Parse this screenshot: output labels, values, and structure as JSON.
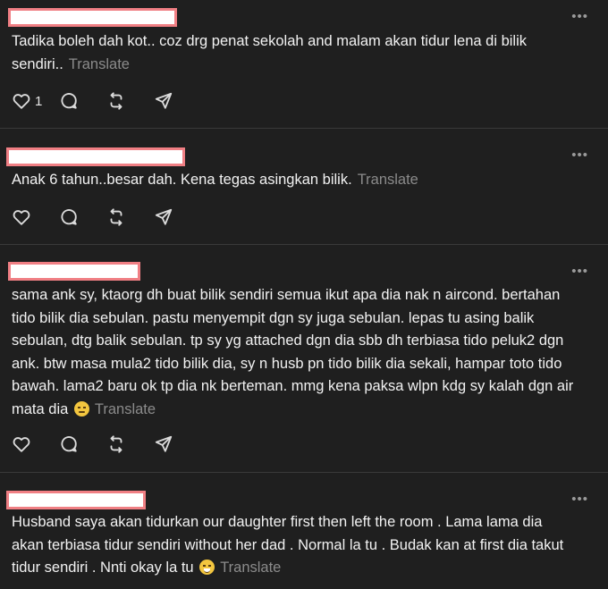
{
  "ui": {
    "translate_label": "Translate",
    "more_label": "•••"
  },
  "posts": [
    {
      "text": "Tadika boleh dah kot.. coz drg penat sekolah and malam akan tidur lena di bilik sendiri..",
      "like_count": "1"
    },
    {
      "text": "Anak 6 tahun..besar dah. Kena tegas asingkan bilik.",
      "like_count": ""
    },
    {
      "text": "sama ank sy, ktaorg dh buat bilik sendiri semua ikut apa dia nak n aircond. bertahan tido bilik dia sebulan. pastu menyempit dgn sy juga sebulan. lepas tu asing balik sebulan, dtg balik sebulan. tp sy yg attached dgn dia sbb dh terbiasa tido peluk2 dgn ank. btw masa mula2 tido bilik dia, sy n husb pn tido bilik dia sekali, hampar toto tido bawah. lama2 baru ok tp dia nk berteman. mmg kena paksa wlpn kdg sy kalah dgn air mata dia",
      "emoji": "downcast-face",
      "like_count": ""
    },
    {
      "text": "Husband saya akan tidurkan our daughter first then left the room . Lama lama dia akan terbiasa tidur sendiri without her dad . Normal la tu . Budak kan at first dia takut tidur sendiri . Nnti okay la tu",
      "emoji": "grinning-face",
      "like_count": ""
    }
  ],
  "colors": {
    "background": "#1f1f1f",
    "text": "#f2f2f2",
    "muted": "#8b8b8b",
    "redaction_fill": "#ffffff",
    "redaction_border": "#f07f84",
    "divider": "#3a3a3a"
  }
}
